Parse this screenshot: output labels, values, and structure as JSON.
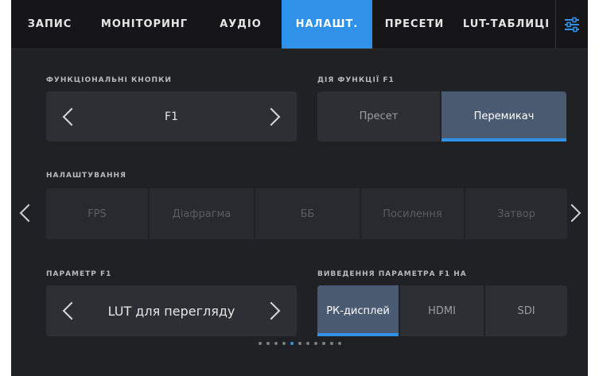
{
  "tabs": [
    {
      "label": "ЗАПИС",
      "active": false
    },
    {
      "label": "МОНІТОРИНГ",
      "active": false
    },
    {
      "label": "АУДІО",
      "active": false
    },
    {
      "label": "НАЛАШТ.",
      "active": true
    },
    {
      "label": "ПРЕСЕТИ",
      "active": false
    },
    {
      "label": "LUT-ТАБЛИЦІ",
      "active": false
    }
  ],
  "function_buttons": {
    "label": "ФУНКЦІОНАЛЬНІ КНОПКИ",
    "value": "F1"
  },
  "f1_action": {
    "label": "ДІЯ ФУНКЦІЇ F1",
    "options": [
      "Пресет",
      "Перемикач"
    ],
    "selected": "Перемикач"
  },
  "settings": {
    "label": "НАЛАШТУВАННЯ",
    "options": [
      "FPS",
      "Діафрагма",
      "ББ",
      "Посилення",
      "Затвор"
    ]
  },
  "f1_param": {
    "label": "ПАРАМЕТР F1",
    "value": "LUT для перегляду"
  },
  "f1_output": {
    "label": "ВИВЕДЕННЯ ПАРАМЕТРА F1 НА",
    "options": [
      "РК-дисплей",
      "HDMI",
      "SDI"
    ],
    "selected": "РК-дисплей"
  },
  "pagination": {
    "total": 11,
    "current": 5
  },
  "colors": {
    "accent": "#2f91e8",
    "background": "#202125",
    "panel": "#2d2f35"
  }
}
